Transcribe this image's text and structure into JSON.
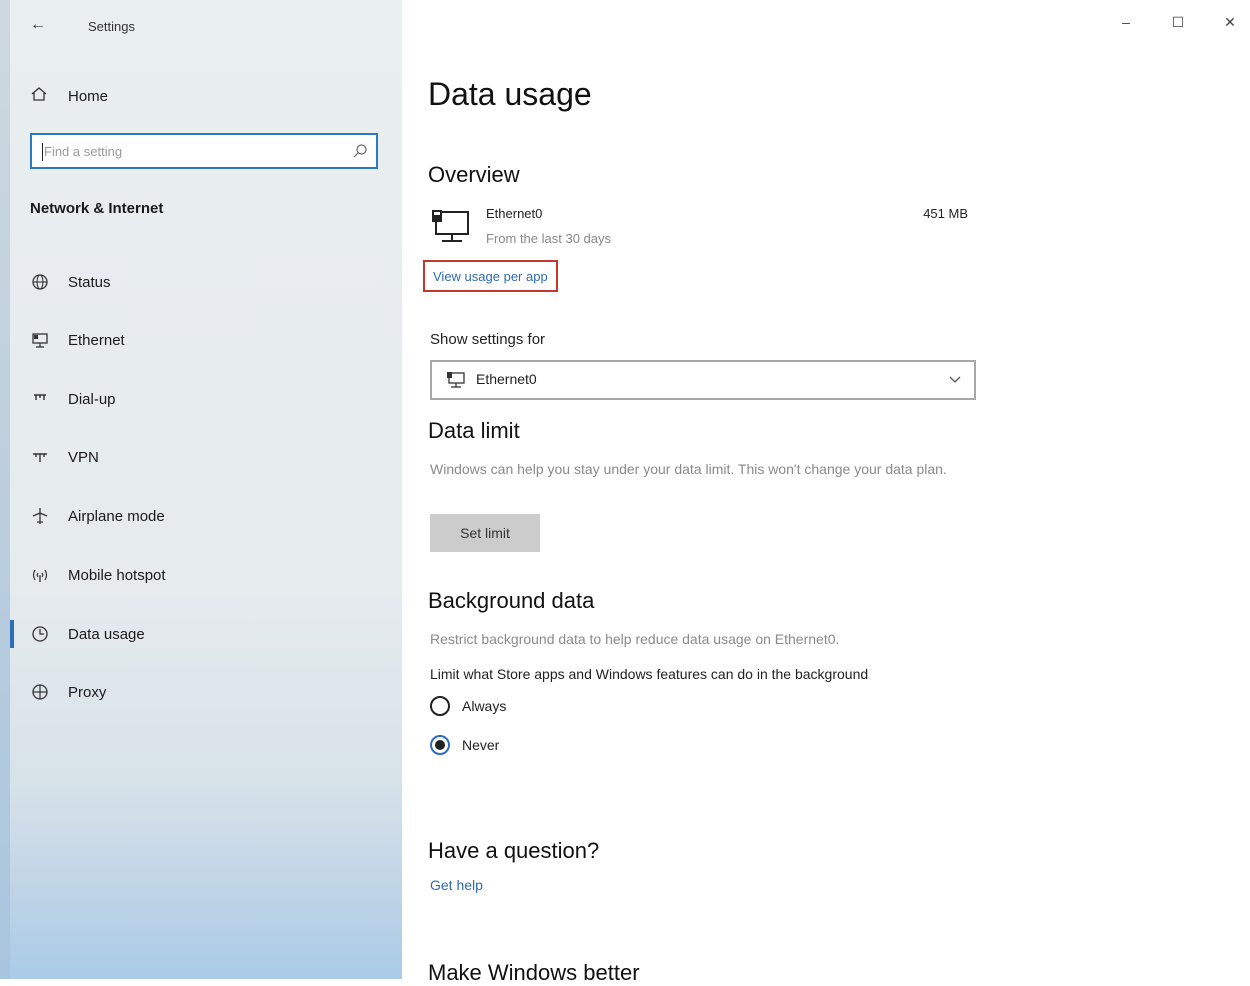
{
  "window": {
    "title": "Settings",
    "controls": {
      "minimize": "–",
      "maximize": "☐",
      "close": "✕"
    }
  },
  "sidebar": {
    "home_label": "Home",
    "search_placeholder": "Find a setting",
    "section_title": "Network & Internet",
    "items": [
      {
        "label": "Status",
        "icon": "globe-icon"
      },
      {
        "label": "Ethernet",
        "icon": "ethernet-icon"
      },
      {
        "label": "Dial-up",
        "icon": "dialup-icon"
      },
      {
        "label": "VPN",
        "icon": "vpn-icon"
      },
      {
        "label": "Airplane mode",
        "icon": "airplane-icon"
      },
      {
        "label": "Mobile hotspot",
        "icon": "hotspot-icon"
      },
      {
        "label": "Data usage",
        "icon": "data-usage-icon",
        "active": true
      },
      {
        "label": "Proxy",
        "icon": "proxy-icon"
      }
    ]
  },
  "main": {
    "title": "Data usage",
    "overview": {
      "heading": "Overview",
      "adapter_name": "Ethernet0",
      "period": "From the last 30 days",
      "amount": "451 MB",
      "view_usage_link": "View usage per app"
    },
    "show_settings": {
      "label": "Show settings for",
      "selected": "Ethernet0"
    },
    "data_limit": {
      "heading": "Data limit",
      "description": "Windows can help you stay under your data limit. This won't change your data plan.",
      "button": "Set limit"
    },
    "background_data": {
      "heading": "Background data",
      "description": "Restrict background data to help reduce data usage on Ethernet0.",
      "prompt": "Limit what Store apps and Windows features can do in the background",
      "options": [
        {
          "label": "Always",
          "checked": false
        },
        {
          "label": "Never",
          "checked": true
        }
      ]
    },
    "question": {
      "heading": "Have a question?",
      "link": "Get help"
    },
    "feedback": {
      "heading": "Make Windows better"
    }
  },
  "colors": {
    "accent": "#2d6fb7",
    "link": "#2e6bb3",
    "highlight_box": "#c0392b"
  }
}
